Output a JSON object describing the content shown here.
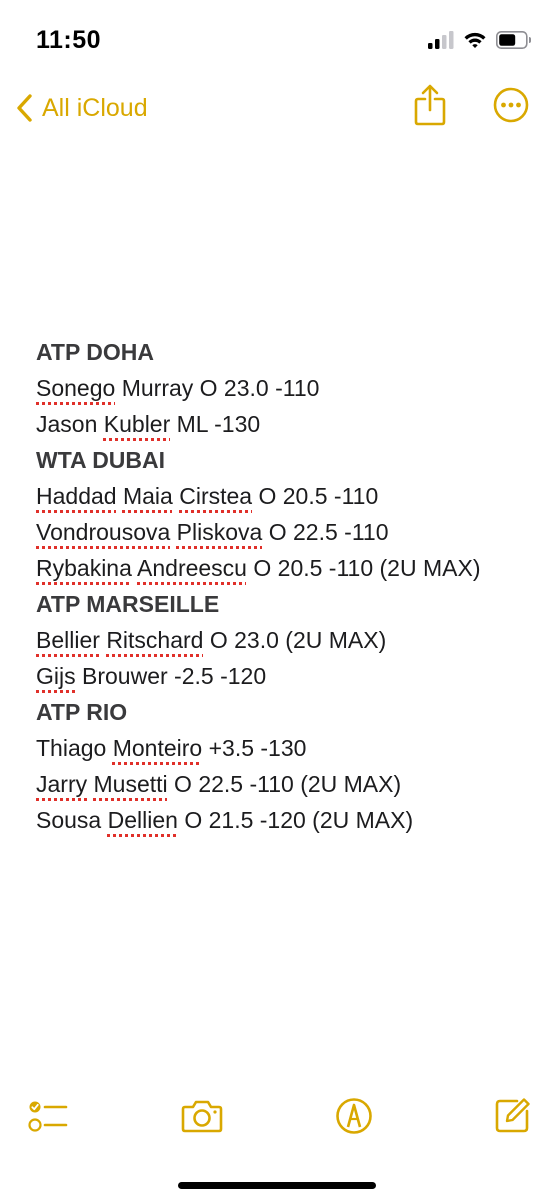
{
  "status_bar": {
    "time": "11:50",
    "icons": [
      "cellular-signal-icon",
      "wifi-icon",
      "battery-icon"
    ]
  },
  "nav": {
    "back_label": "All iCloud",
    "accent_color": "#d9a800",
    "icons": [
      "chevron-left-icon",
      "share-icon",
      "more-icon"
    ]
  },
  "note": {
    "lines": [
      {
        "type": "heading",
        "text": "ATP DOHA"
      },
      {
        "type": "text",
        "parts": [
          {
            "t": "Sonego",
            "sp": true
          },
          {
            "t": " Murray O 23.0 -110"
          }
        ]
      },
      {
        "type": "text",
        "parts": [
          {
            "t": "Jason "
          },
          {
            "t": "Kubler",
            "sp": true
          },
          {
            "t": " ML -130"
          }
        ]
      },
      {
        "type": "heading",
        "text": "WTA DUBAI"
      },
      {
        "type": "text",
        "parts": [
          {
            "t": "Haddad",
            "sp": true
          },
          {
            "t": " "
          },
          {
            "t": "Maia",
            "sp": true
          },
          {
            "t": " "
          },
          {
            "t": "Cirstea",
            "sp": true
          },
          {
            "t": " O 20.5 -110"
          }
        ]
      },
      {
        "type": "text",
        "parts": [
          {
            "t": "Vondrousova",
            "sp": true
          },
          {
            "t": " "
          },
          {
            "t": "Pliskova",
            "sp": true
          },
          {
            "t": " O 22.5 -110"
          }
        ]
      },
      {
        "type": "text",
        "wrap": true,
        "parts": [
          {
            "t": "Rybakina",
            "sp": true
          },
          {
            "t": " "
          },
          {
            "t": "Andreescu",
            "sp": true
          },
          {
            "t": " O 20.5 -110 (2U MAX)"
          }
        ]
      },
      {
        "type": "heading",
        "text": "ATP MARSEILLE"
      },
      {
        "type": "text",
        "parts": [
          {
            "t": "Bellier",
            "sp": true
          },
          {
            "t": " "
          },
          {
            "t": "Ritschard",
            "sp": true
          },
          {
            "t": " O 23.0 (2U MAX)"
          }
        ]
      },
      {
        "type": "text",
        "parts": [
          {
            "t": "Gijs",
            "sp": true
          },
          {
            "t": " Brouwer -2.5 -120"
          }
        ]
      },
      {
        "type": "heading",
        "text": "ATP RIO"
      },
      {
        "type": "text",
        "parts": [
          {
            "t": "Thiago "
          },
          {
            "t": "Monteiro",
            "sp": true
          },
          {
            "t": " +3.5 -130"
          }
        ]
      },
      {
        "type": "text",
        "parts": [
          {
            "t": "Jarry",
            "sp": true
          },
          {
            "t": " "
          },
          {
            "t": "Musetti",
            "sp": true
          },
          {
            "t": " O 22.5 -110 (2U MAX)"
          }
        ]
      },
      {
        "type": "text",
        "parts": [
          {
            "t": "Sousa "
          },
          {
            "t": "Dellien",
            "sp": true
          },
          {
            "t": " O 21.5 -120 (2U MAX)"
          }
        ]
      }
    ],
    "spellcheck_color": "#e0302a"
  },
  "toolbar": {
    "icons": [
      "checklist-icon",
      "camera-icon",
      "markup-pen-icon",
      "compose-icon"
    ]
  }
}
